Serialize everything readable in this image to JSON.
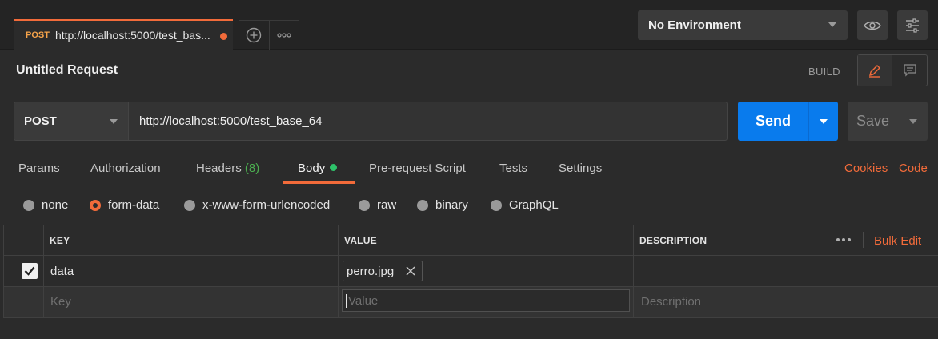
{
  "tab": {
    "method": "POST",
    "title": "http://localhost:5000/test_bas..."
  },
  "environment": {
    "selected": "No Environment"
  },
  "request": {
    "name": "Untitled Request",
    "mode_label": "BUILD"
  },
  "url_bar": {
    "method": "POST",
    "url": "http://localhost:5000/test_base_64",
    "send_label": "Send",
    "save_label": "Save"
  },
  "subtabs": {
    "params": "Params",
    "authorization": "Authorization",
    "headers": "Headers",
    "headers_count": "(8)",
    "body": "Body",
    "prerequest": "Pre-request Script",
    "tests": "Tests",
    "settings": "Settings",
    "cookies": "Cookies",
    "code": "Code"
  },
  "body_types": {
    "none": "none",
    "form_data": "form-data",
    "urlencoded": "x-www-form-urlencoded",
    "raw": "raw",
    "binary": "binary",
    "graphql": "GraphQL",
    "selected": "form-data"
  },
  "table": {
    "headers": {
      "key": "KEY",
      "value": "VALUE",
      "description": "DESCRIPTION",
      "bulk_edit": "Bulk Edit"
    },
    "rows": [
      {
        "checked": true,
        "key": "data",
        "value_file": "perro.jpg",
        "description": ""
      }
    ],
    "new_row": {
      "key_placeholder": "Key",
      "value_placeholder": "Value",
      "description_placeholder": "Description"
    }
  },
  "colors": {
    "accent": "#f26b3a",
    "primary": "#097bed",
    "success": "#2ec26a",
    "background": "#2b2b2b"
  }
}
